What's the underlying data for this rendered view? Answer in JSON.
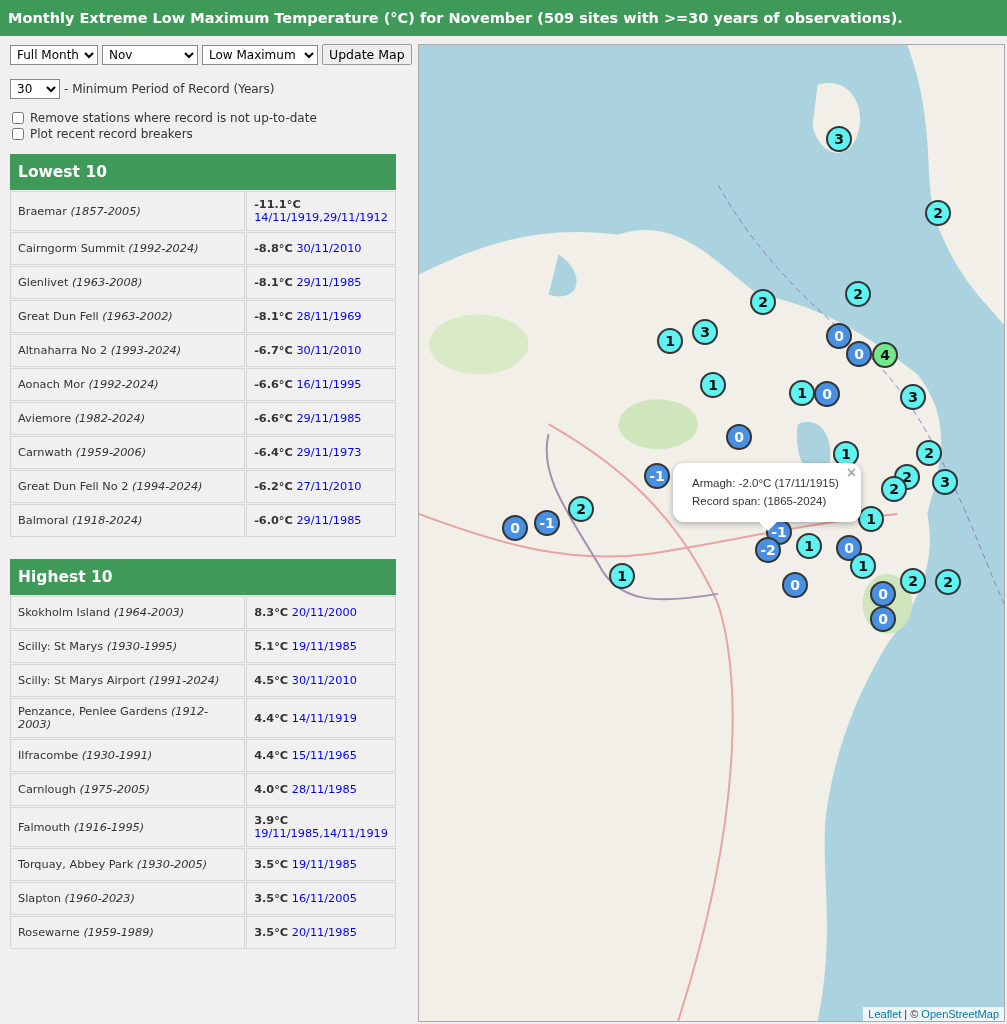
{
  "title": "Monthly Extreme Low Maximum Temperature (°C) for November (509 sites with >=30 years of observations).",
  "controls": {
    "period_select": "Full Month",
    "month_select": "Nov",
    "measure_select": "Low Maximum",
    "update_button": "Update Map",
    "years_select": "30",
    "years_label": "- Minimum Period of Record (Years)",
    "checkboxes": [
      {
        "label": "Remove stations where record is not up-to-date",
        "checked": false
      },
      {
        "label": "Plot recent record breakers",
        "checked": false
      }
    ]
  },
  "tables": [
    {
      "heading": "Lowest 10",
      "rows": [
        {
          "station": "Braemar *(1857-2005)*",
          "value": "-11.1°C",
          "dates": [
            "14/11/1919,",
            "29/11/1912"
          ]
        },
        {
          "station": "Cairngorm Summit *(1992-2024)*",
          "value": "-8.8°C",
          "dates": [
            "30/11/2010"
          ]
        },
        {
          "station": "Glenlivet *(1963-2008)*",
          "value": "-8.1°C",
          "dates": [
            "29/11/1985"
          ]
        },
        {
          "station": "Great Dun Fell *(1963-2002)*",
          "value": "-8.1°C",
          "dates": [
            "28/11/1969"
          ]
        },
        {
          "station": "Altnaharra No 2 *(1993-2024)*",
          "value": "-6.7°C",
          "dates": [
            "30/11/2010"
          ]
        },
        {
          "station": "Aonach Mor *(1992-2024)*",
          "value": "-6.6°C",
          "dates": [
            "16/11/1995"
          ]
        },
        {
          "station": "Aviemore *(1982-2024)*",
          "value": "-6.6°C",
          "dates": [
            "29/11/1985"
          ]
        },
        {
          "station": "Carnwath *(1959-2006)*",
          "value": "-6.4°C",
          "dates": [
            "29/11/1973"
          ]
        },
        {
          "station": "Great Dun Fell No 2 *(1994-2024)*",
          "value": "-6.2°C",
          "dates": [
            "27/11/2010"
          ]
        },
        {
          "station": "Balmoral *(1918-2024)*",
          "value": "-6.0°C",
          "dates": [
            "29/11/1985"
          ]
        }
      ]
    },
    {
      "heading": "Highest 10",
      "rows": [
        {
          "station": "Skokholm Island *(1964-2003)*",
          "value": "8.3°C",
          "dates": [
            "20/11/2000"
          ]
        },
        {
          "station": "Scilly: St Marys *(1930-1995)*",
          "value": "5.1°C",
          "dates": [
            "19/11/1985"
          ]
        },
        {
          "station": "Scilly: St Marys Airport *(1991-2024)*",
          "value": "4.5°C",
          "dates": [
            "30/11/2010"
          ]
        },
        {
          "station": "Penzance, Penlee Gardens *(1912-2003)*",
          "value": "4.4°C",
          "dates": [
            "14/11/1919"
          ]
        },
        {
          "station": "Ilfracombe *(1930-1991)*",
          "value": "4.4°C",
          "dates": [
            "15/11/1965"
          ]
        },
        {
          "station": "Carnlough *(1975-2005)*",
          "value": "4.0°C",
          "dates": [
            "28/11/1985"
          ]
        },
        {
          "station": "Falmouth *(1916-1995)*",
          "value": "3.9°C",
          "dates": [
            "19/11/1985,",
            "14/11/1919"
          ]
        },
        {
          "station": "Torquay, Abbey Park *(1930-2005)*",
          "value": "3.5°C",
          "dates": [
            "19/11/1985"
          ]
        },
        {
          "station": "Slapton *(1960-2023)*",
          "value": "3.5°C",
          "dates": [
            "16/11/2005"
          ]
        },
        {
          "station": "Rosewarne *(1959-1989)*",
          "value": "3.5°C",
          "dates": [
            "20/11/1985"
          ]
        }
      ]
    }
  ],
  "map": {
    "kind": "picture",
    "markers": [
      {
        "label": "3",
        "color": "#5ef2f0"
      },
      {
        "label": "2",
        "color": "#5ef2f0"
      },
      {
        "label": "2",
        "color": "#5ef2f0"
      },
      {
        "label": "2",
        "color": "#5ef2f0"
      },
      {
        "label": "1",
        "color": "#5ef2f0"
      },
      {
        "label": "3",
        "color": "#5ef2f0"
      },
      {
        "label": "0",
        "color": "#4a90e2"
      },
      {
        "label": "0",
        "color": "#4a90e2"
      },
      {
        "label": "4",
        "color": "#72e88a"
      },
      {
        "label": "1",
        "color": "#5ef2f0"
      },
      {
        "label": "1",
        "color": "#5ef2f0"
      },
      {
        "label": "0",
        "color": "#4a90e2"
      },
      {
        "label": "3",
        "color": "#5ef2f0"
      },
      {
        "label": "0",
        "color": "#4a90e2"
      },
      {
        "label": "1",
        "color": "#5ef2f0"
      },
      {
        "label": "-1",
        "color": "#4a90e2"
      },
      {
        "label": "2",
        "color": "#5ef2f0"
      },
      {
        "label": "2",
        "color": "#5ef2f0"
      },
      {
        "label": "2",
        "color": "#5ef2f0"
      },
      {
        "label": "3",
        "color": "#5ef2f0"
      },
      {
        "label": "2",
        "color": "#5ef2f0"
      },
      {
        "label": "0",
        "color": "#4a90e2"
      },
      {
        "label": "-1",
        "color": "#4a90e2"
      },
      {
        "label": "1",
        "color": "#5ef2f0"
      },
      {
        "label": "-1",
        "color": "#4a90e2"
      },
      {
        "label": "-2",
        "color": "#4a90e2"
      },
      {
        "label": "1",
        "color": "#5ef2f0"
      },
      {
        "label": "0",
        "color": "#4a90e2"
      },
      {
        "label": "1",
        "color": "#5ef2f0"
      },
      {
        "label": "1",
        "color": "#5ef2f0"
      },
      {
        "label": "0",
        "color": "#4a90e2"
      },
      {
        "label": "2",
        "color": "#5ef2f0"
      },
      {
        "label": "2",
        "color": "#5ef2f0"
      },
      {
        "label": "0",
        "color": "#4a90e2"
      },
      {
        "label": "0",
        "color": "#4a90e2"
      }
    ],
    "popup": {
      "lines": [
        "Armagh: -2.0°C (17/11/1915)",
        "Record span: (1865-2024)"
      ],
      "close": "×"
    },
    "attribution": {
      "leaflet_link": "Leaflet",
      "separator": "| ©",
      "osm_link": "OpenStreetMap"
    }
  }
}
